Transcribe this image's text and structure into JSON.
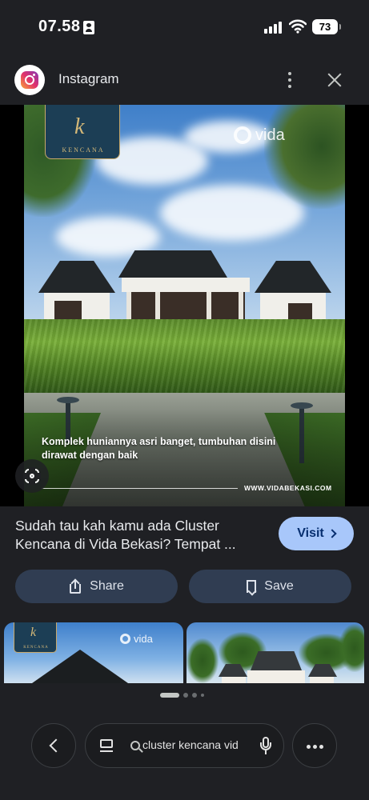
{
  "status_bar": {
    "time": "07.58",
    "battery": "73"
  },
  "source": {
    "name": "Instagram",
    "icon": "instagram-icon"
  },
  "image": {
    "logo_text": "KENCANA",
    "logo_mark": "k",
    "brand": "vida",
    "caption": "Komplek huniannya asri banget, tumbuhan disini dirawat dengan baik",
    "url": "WWW.VIDABEKASI.COM"
  },
  "result": {
    "title": "Sudah tau kah kamu ada Cluster Kencana di Vida Bekasi? Tempat ...",
    "visit_label": "Visit"
  },
  "actions": {
    "share_label": "Share",
    "save_label": "Save"
  },
  "related": {
    "thumb1_logo_text": "KENCANA",
    "thumb1_brand": "vida"
  },
  "bottom_bar": {
    "search_query": "cluster kencana vid"
  },
  "colors": {
    "background": "#1f2024",
    "visit_button": "#a8c7fa",
    "action_button": "#303d52"
  }
}
